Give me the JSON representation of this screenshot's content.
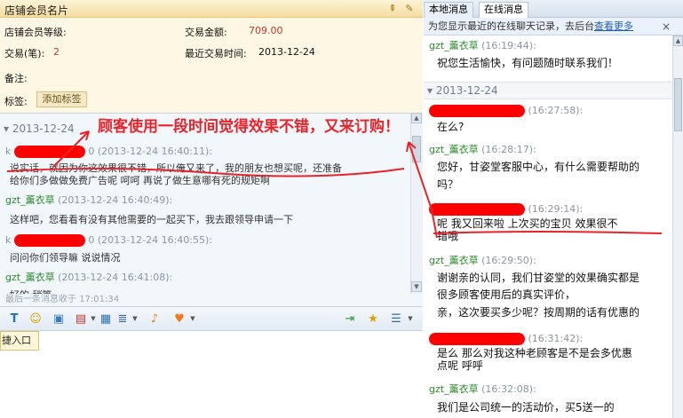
{
  "left_panel": {
    "card_title": "店铺会员名片",
    "member_level_label": "店铺会员等级:",
    "trade_amount_label": "交易金额:",
    "trade_amount_value": "709.00",
    "trade_count_label": "交易(笔):",
    "trade_count_value": "2",
    "last_trade_time_label": "最近交易时间:",
    "last_trade_time_value": "2013-12-24",
    "remark_label": "备注:",
    "tag_label": "标签:",
    "add_tag_button": "添加标签",
    "chat": {
      "date": "2013-12-24",
      "messages": [
        {
          "sender_visible": "k",
          "sender_tail": "0",
          "time": "(2013-12-24 16:40:11):",
          "body": "说实话，就因为你这效果很不错，所以俺又来了，我的朋友也想买呢，还准备",
          "body2": "给你们多做做免费广告呢  呵呵  再说了做生意哪有死的规矩啊"
        },
        {
          "sender": "gzt_薰衣草",
          "time": "(2013-12-24 16:40:49):",
          "body": "这样吧，您看看有没有其他需要的一起买下，我去跟领导申请一下"
        },
        {
          "sender_visible": "k",
          "sender_tail": "0",
          "time": "(2013-12-24 16:40:55):",
          "body": "问问你们领导嘛  说说情况"
        },
        {
          "sender": "gzt_薰衣草",
          "time": "(2013-12-24 16:41:08):",
          "body": "好的  稍等"
        }
      ]
    },
    "last_message_label": "最后一条消息收于",
    "last_message_time": "17:01:34",
    "tip_text": "捷入口",
    "annotation": "顾客使用一段时间觉得效果不错，又来订购！"
  },
  "right_panel": {
    "tabs": [
      {
        "label": "本地消息"
      },
      {
        "label": "在线消息"
      }
    ],
    "notice_text": "为您显示最近的在线聊天记录，去后台",
    "notice_link": "查看更多",
    "close": "×",
    "messages": [
      {
        "sender": "gzt_薰衣草",
        "time": "(16:19:44):",
        "body": "祝您生活愉快，有问题随时联系我们！"
      },
      {
        "date": "2013-12-24"
      },
      {
        "time": "(16:27:58):",
        "body": "在么?"
      },
      {
        "sender": "gzt_薰衣草",
        "time": "(16:28:17):",
        "body": "您好，甘姿堂客服中心，有什么需要帮助的",
        "body2": "吗？"
      },
      {
        "time": "(16:29:14):",
        "body": "呢    我又回来啦    上次买的宝贝  效果很不",
        "body2": "错哦"
      },
      {
        "sender": "gzt_薰衣草",
        "time": "(16:29:50):",
        "body": "谢谢亲的认同，我们甘姿堂的效果确实都是",
        "body2": "很多顾客使用后的真实评价，",
        "body3": "亲，这次要买多少呢？按周期的话有优惠的"
      },
      {
        "time": "(16:31:42):",
        "body": "是么    那么对我这种老顾客是不是会多优惠",
        "body2": "点呢    呼呼"
      },
      {
        "sender": "gzt_薰衣草",
        "time": "(16:32:08):",
        "body": "我们是公司统一的活动价，买5送一的"
      }
    ]
  },
  "colors": {
    "annotation_red": "#e8232a",
    "sender_green": "#2a8a2a",
    "link_blue": "#1f5fb8"
  }
}
